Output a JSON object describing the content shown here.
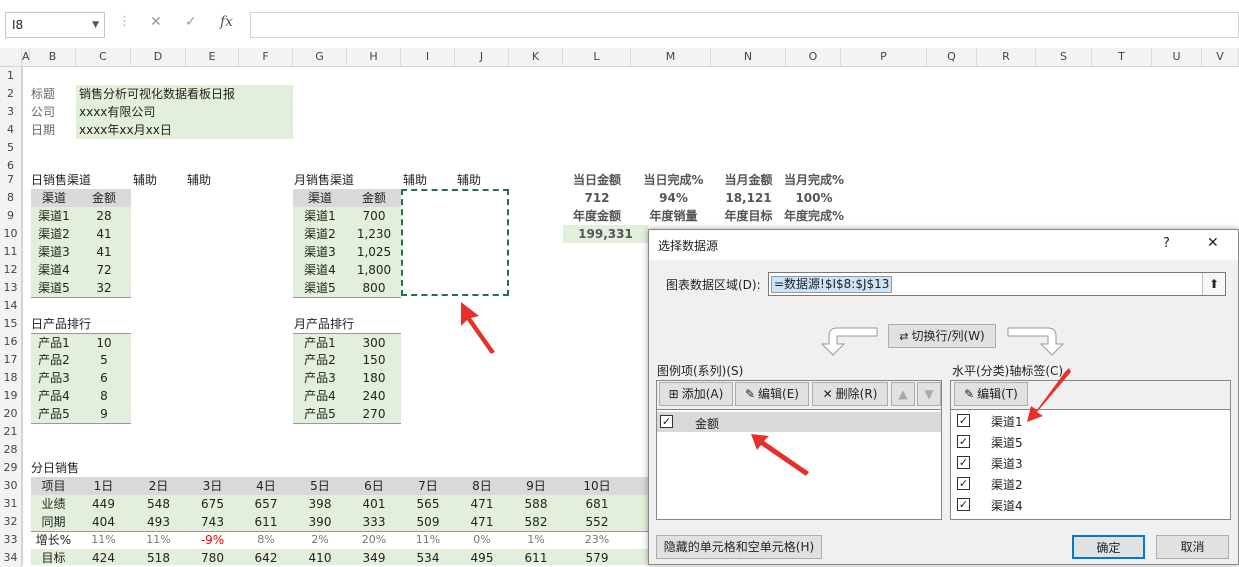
{
  "formula_bar": {
    "cell_ref": "I8",
    "cancel_icon": "✕",
    "enter_icon": "✓",
    "fx_label": "fx"
  },
  "columns": [
    "A",
    "B",
    "C",
    "D",
    "E",
    "F",
    "G",
    "H",
    "I",
    "J",
    "K",
    "L",
    "M",
    "N",
    "O",
    "P",
    "Q",
    "R",
    "S",
    "T",
    "U",
    "V"
  ],
  "rows": [
    "1",
    "2",
    "3",
    "4",
    "5",
    "6",
    "7",
    "8",
    "9",
    "10",
    "11",
    "12",
    "13",
    "14",
    "15",
    "16",
    "17",
    "18",
    "19",
    "20",
    "21",
    "28",
    "29",
    "30",
    "31",
    "32",
    "33",
    "34"
  ],
  "info": {
    "title_label": "标题",
    "title_value": "销售分析可视化数据看板日报",
    "company_label": "公司",
    "company_value": "xxxx有限公司",
    "date_label": "日期",
    "date_value": "xxxx年xx月xx日"
  },
  "daily_channel": {
    "heading": "日销售渠道",
    "aux1": "辅助",
    "aux2": "辅助",
    "col1": "渠道",
    "col2": "金额",
    "rows": [
      [
        "渠道1",
        "28"
      ],
      [
        "渠道2",
        "41"
      ],
      [
        "渠道3",
        "41"
      ],
      [
        "渠道4",
        "72"
      ],
      [
        "渠道5",
        "32"
      ]
    ]
  },
  "monthly_channel": {
    "heading": "月销售渠道",
    "aux1": "辅助",
    "aux2": "辅助",
    "col1": "渠道",
    "col2": "金额",
    "rows": [
      [
        "渠道1",
        "700"
      ],
      [
        "渠道2",
        "1,230"
      ],
      [
        "渠道3",
        "1,025"
      ],
      [
        "渠道4",
        "1,800"
      ],
      [
        "渠道5",
        "800"
      ]
    ]
  },
  "daily_product": {
    "heading": "日产品排行",
    "rows": [
      [
        "产品1",
        "10"
      ],
      [
        "产品2",
        "5"
      ],
      [
        "产品3",
        "6"
      ],
      [
        "产品4",
        "8"
      ],
      [
        "产品5",
        "9"
      ]
    ]
  },
  "monthly_product": {
    "heading": "月产品排行",
    "rows": [
      [
        "产品1",
        "300"
      ],
      [
        "产品2",
        "150"
      ],
      [
        "产品3",
        "180"
      ],
      [
        "产品4",
        "240"
      ],
      [
        "产品5",
        "270"
      ]
    ]
  },
  "kpi": {
    "h1": "当日金额",
    "h2": "当日完成%",
    "h3": "当月金额",
    "h4": "当月完成%",
    "v1": "712",
    "v2": "94%",
    "v3": "18,121",
    "v4": "100%",
    "h5": "年度金额",
    "h6": "年度销量",
    "h7": "年度目标",
    "h8": "年度完成%",
    "v5": "199,331"
  },
  "daily_sales": {
    "heading": "分日销售",
    "header": [
      "项目",
      "1日",
      "2日",
      "3日",
      "4日",
      "5日",
      "6日",
      "7日",
      "8日",
      "9日",
      "10日"
    ],
    "rows": [
      [
        "业绩",
        "449",
        "548",
        "675",
        "657",
        "398",
        "401",
        "565",
        "471",
        "588",
        "681"
      ],
      [
        "同期",
        "404",
        "493",
        "743",
        "611",
        "390",
        "333",
        "509",
        "471",
        "582",
        "552"
      ],
      [
        "增长%",
        "11%",
        "11%",
        "-9%",
        "8%",
        "2%",
        "20%",
        "11%",
        "0%",
        "1%",
        "23%"
      ],
      [
        "目标",
        "424",
        "518",
        "780",
        "642",
        "410",
        "349",
        "534",
        "495",
        "611",
        "579"
      ]
    ]
  },
  "dialog": {
    "title": "选择数据源",
    "help": "?",
    "close": "✕",
    "range_label": "图表数据区域(D):",
    "range_value": "=数据源!$I$8:$J$13",
    "switch_button": "切换行/列(W)",
    "legend_label": "图例项(系列)(S)",
    "add_button": "添加(A)",
    "edit_button": "编辑(E)",
    "delete_button": "删除(R)",
    "series": [
      {
        "label": "金额",
        "checked": true
      }
    ],
    "axis_label": "水平(分类)轴标签(C)",
    "axis_edit_button": "编辑(T)",
    "categories": [
      {
        "label": "渠道1",
        "checked": true
      },
      {
        "label": "渠道5",
        "checked": true
      },
      {
        "label": "渠道3",
        "checked": true
      },
      {
        "label": "渠道2",
        "checked": true
      },
      {
        "label": "渠道4",
        "checked": true
      }
    ],
    "hidden_cells_button": "隐藏的单元格和空单元格(H)",
    "ok_button": "确定",
    "cancel_button": "取消"
  },
  "colors": {
    "accent_green": "#e2efda",
    "selection_border": "#217346",
    "arrow_red": "#e8302a",
    "header_gray": "#d9d9d9"
  }
}
